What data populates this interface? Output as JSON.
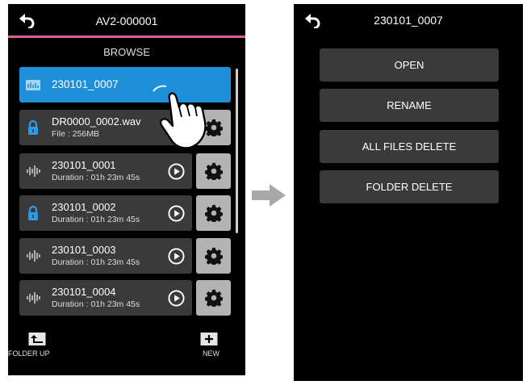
{
  "left": {
    "title": "AV2-000001",
    "section": "BROWSE",
    "files": [
      {
        "name": "230101_0007",
        "detail": "",
        "icon": "folder-icon",
        "locked": false,
        "selected": true
      },
      {
        "name": "DR0000_0002.wav",
        "detail": "File : 256MB",
        "icon": "lock-icon",
        "locked": true,
        "selected": false
      },
      {
        "name": "230101_0001",
        "detail": "Duration : 01h 23m 45s",
        "icon": "waveform-icon",
        "locked": false,
        "selected": false
      },
      {
        "name": "230101_0002",
        "detail": "Duration : 01h 23m 45s",
        "icon": "lock-icon",
        "locked": true,
        "selected": false
      },
      {
        "name": "230101_0003",
        "detail": "Duration : 01h 23m 45s",
        "icon": "waveform-icon",
        "locked": false,
        "selected": false
      },
      {
        "name": "230101_0004",
        "detail": "Duration : 01h 23m 45s",
        "icon": "waveform-icon",
        "locked": false,
        "selected": false
      }
    ],
    "folder_up_label": "FOLDER UP",
    "new_label": "NEW"
  },
  "right": {
    "title": "230101_0007",
    "menu": [
      "OPEN",
      "RENAME",
      "ALL FILES DELETE",
      "FOLDER DELETE"
    ]
  },
  "colors": {
    "accent_pink": "#d9609a",
    "selected_blue": "#1e8fd8",
    "row_bg": "#3a3a3a",
    "gear_bg": "#b3b3b3"
  }
}
